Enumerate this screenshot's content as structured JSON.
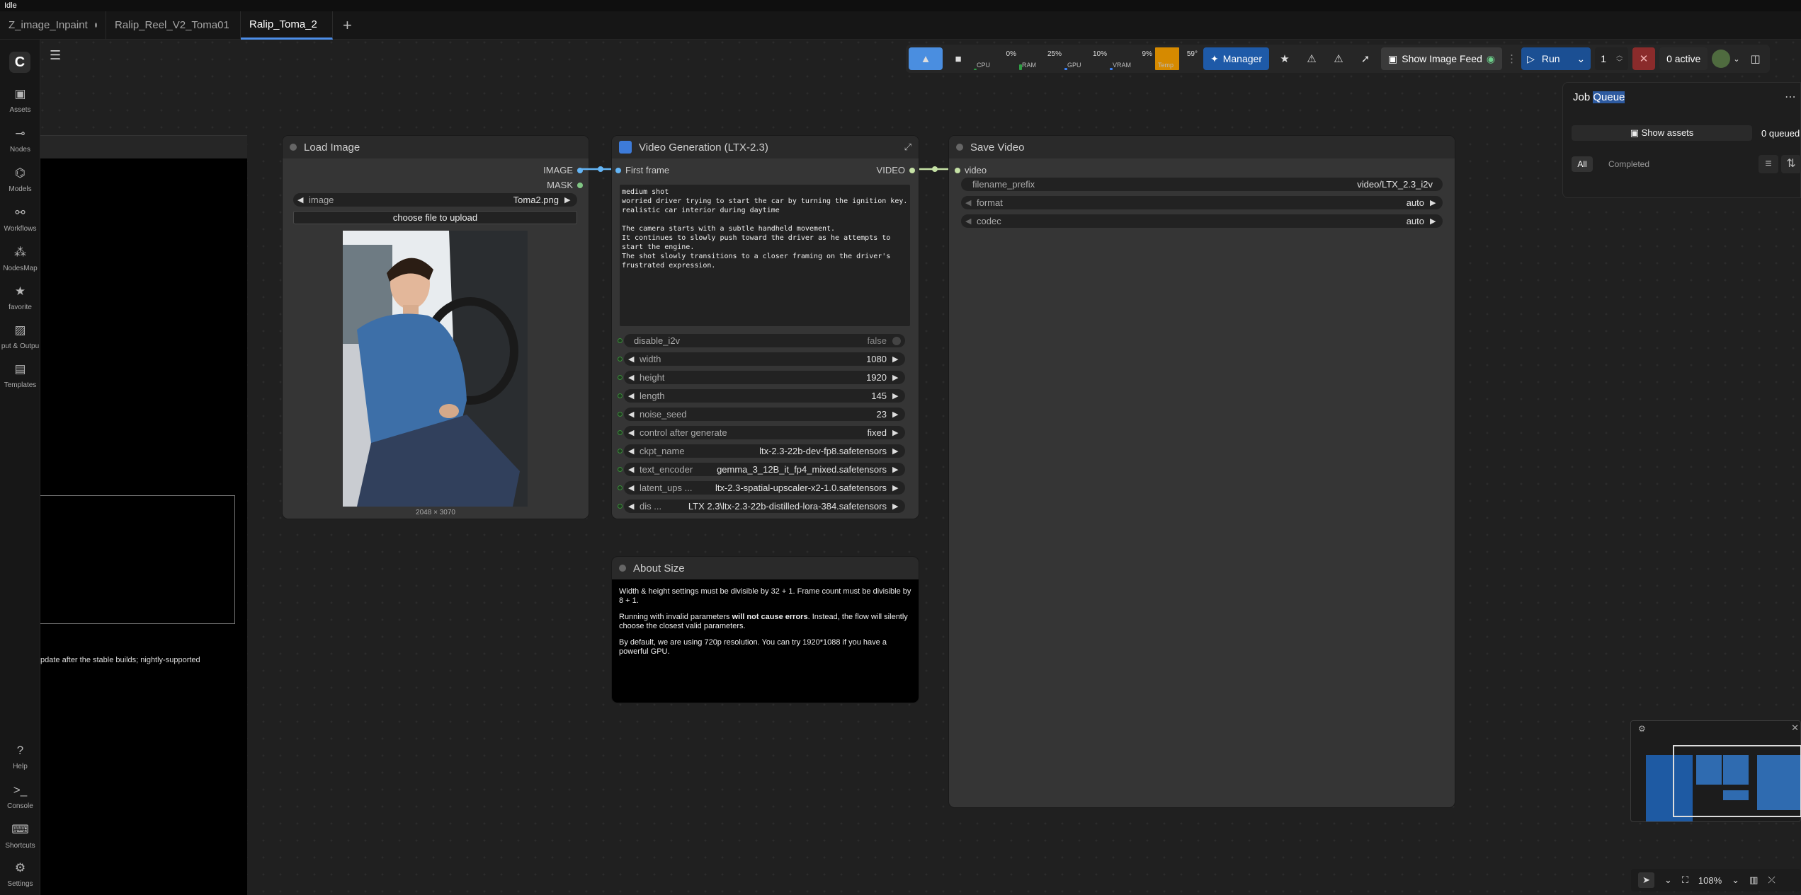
{
  "window": {
    "status": "Idle"
  },
  "tabs": [
    {
      "label": "Z_image_Inpaint",
      "modified": true
    },
    {
      "label": "Ralip_Reel_V2_Toma01",
      "modified": false
    },
    {
      "label": "Ralip_Toma_2",
      "modified": true,
      "active": true
    }
  ],
  "sidebar": {
    "logo": "C",
    "items": [
      {
        "label": "Assets",
        "icon": "image-icon"
      },
      {
        "label": "Nodes",
        "icon": "nodes-icon"
      },
      {
        "label": "Models",
        "icon": "models-icon"
      },
      {
        "label": "Workflows",
        "icon": "workflows-icon"
      },
      {
        "label": "NodesMap",
        "icon": "nodesmap-icon"
      },
      {
        "label": "favorite",
        "icon": "star-icon"
      },
      {
        "label": "put & Outpu",
        "icon": "io-icon"
      },
      {
        "label": "Templates",
        "icon": "templates-icon"
      },
      {
        "label": "Help",
        "icon": "help-icon"
      },
      {
        "label": "Console",
        "icon": "console-icon"
      },
      {
        "label": "Shortcuts",
        "icon": "keyboard-icon"
      },
      {
        "label": "Settings",
        "icon": "gear-icon"
      }
    ]
  },
  "left_panel": {
    "note": "pdate after the stable builds; nightly-supported"
  },
  "toolbar": {
    "meters": [
      {
        "label": "CPU",
        "value": "0%",
        "color": "#2f9e44",
        "fill": 0
      },
      {
        "label": "RAM",
        "value": "25%",
        "color": "#2f9e44",
        "fill": 0.25
      },
      {
        "label": "GPU",
        "value": "10%",
        "color": "#3b82f6",
        "fill": 0.1
      },
      {
        "label": "VRAM",
        "value": "9%",
        "color": "#3b82f6",
        "fill": 0.09
      },
      {
        "label": "Temp",
        "value": "59°",
        "color": "#d68a00",
        "fill": 1
      }
    ],
    "manager": "Manager",
    "show_feed": "Show Image Feed",
    "run": "Run",
    "batch": "1",
    "active": "0 active"
  },
  "job_queue": {
    "title_plain": "Job ",
    "title_hl": "Queue",
    "show_assets": "Show assets",
    "queued": "0 queued",
    "tab_all": "All",
    "tab_completed": "Completed"
  },
  "load_image": {
    "title": "Load Image",
    "out_image": "IMAGE",
    "out_mask": "MASK",
    "image_label": "image",
    "image_value": "Toma2.png",
    "upload": "choose file to upload",
    "dims": "2048 × 3070"
  },
  "video_gen": {
    "title": "Video Generation (LTX-2.3)",
    "in_first": "First frame",
    "out_video": "VIDEO",
    "prompt": "medium shot\nworried driver trying to start the car by turning the ignition key.\nrealistic car interior during daytime\n\nThe camera starts with a subtle handheld movement.\nIt continues to slowly push toward the driver as he attempts to\nstart the engine.\nThe shot slowly transitions to a closer framing on the driver's\nfrustrated expression.",
    "widgets": [
      {
        "label": "disable_i2v",
        "value": "false"
      },
      {
        "label": "width",
        "value": "1080"
      },
      {
        "label": "height",
        "value": "1920"
      },
      {
        "label": "length",
        "value": "145"
      },
      {
        "label": "noise_seed",
        "value": "23"
      },
      {
        "label": "control after generate",
        "value": "fixed"
      },
      {
        "label": "ckpt_name",
        "value": "ltx-2.3-22b-dev-fp8.safetensors"
      },
      {
        "label": "text_encoder",
        "value": "gemma_3_12B_it_fp4_mixed.safetensors"
      },
      {
        "label": "latent_ups ...",
        "value": "ltx-2.3-spatial-upscaler-x2-1.0.safetensors"
      },
      {
        "label": "dis ...",
        "value": "LTX 2.3\\ltx-2.3-22b-distilled-lora-384.safetensors"
      }
    ]
  },
  "save_video": {
    "title": "Save Video",
    "in_video": "video",
    "widgets": [
      {
        "label": "filename_prefix",
        "value": "video/LTX_2.3_i2v"
      },
      {
        "label": "format",
        "value": "auto"
      },
      {
        "label": "codec",
        "value": "auto"
      }
    ]
  },
  "about": {
    "title": "About Size",
    "p1": "Width & height settings must be divisible by 32 + 1. Frame count must be divisible by 8 + 1.",
    "p2a": "Running with invalid parameters ",
    "p2b": "will not cause errors",
    "p2c": ". Instead, the flow will silently choose the closest valid parameters.",
    "p3": "By default, we are using 720p resolution. You can try 1920*1088 if you have a powerful GPU."
  },
  "zoom": "108%"
}
